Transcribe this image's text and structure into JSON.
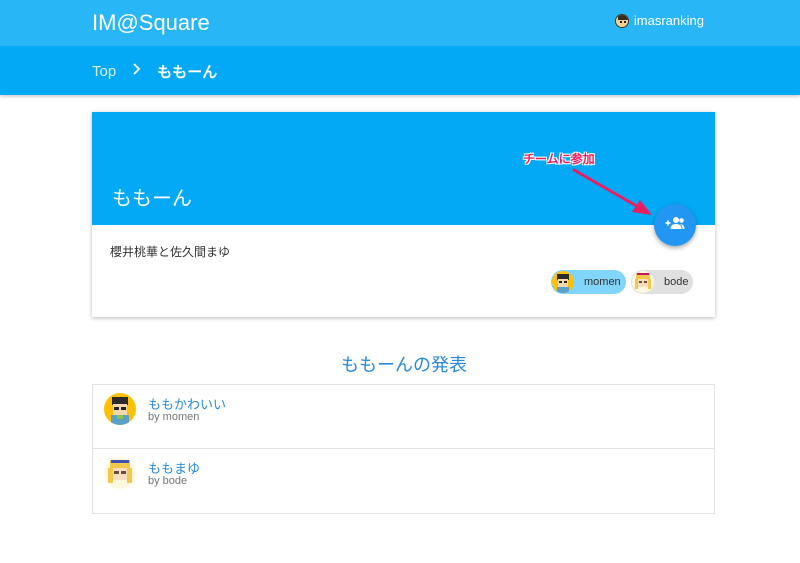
{
  "header": {
    "brand": "IM@Square",
    "user": {
      "name": "imasranking",
      "icon": "user-avatar"
    }
  },
  "breadcrumb": {
    "top": "Top",
    "separator": ">",
    "current": "ももーん"
  },
  "team": {
    "name": "ももーん",
    "description": "櫻井桃華と佐久間まゆ",
    "join_icon": "group-add-icon",
    "members": [
      {
        "name": "momen",
        "color": "#81d4fa"
      },
      {
        "name": "bode",
        "color": "#e0e0e0"
      }
    ]
  },
  "annotation": {
    "text": "チームに参加",
    "color": "#e91e63"
  },
  "presentations": {
    "title": "ももーんの発表",
    "items": [
      {
        "title": "ももかわいい",
        "author": "by momen"
      },
      {
        "title": "ももまゆ",
        "author": "by bode"
      }
    ]
  },
  "colors": {
    "header": "#29b6f6",
    "breadcrumb_bar": "#03a9f4",
    "fab": "#2196f3",
    "link": "#2a8ad6"
  }
}
